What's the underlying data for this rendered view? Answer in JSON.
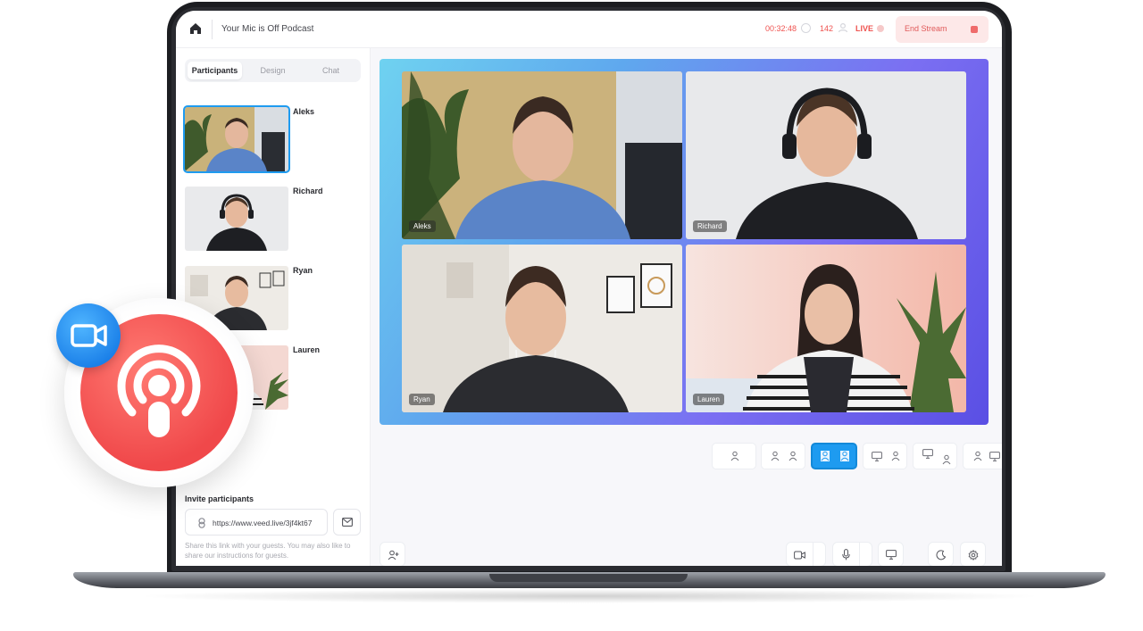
{
  "header": {
    "title": "Your Mic is Off Podcast",
    "timer": "00:32:48",
    "viewer_count": "142",
    "live_label": "LIVE",
    "end_stream_label": "End Stream"
  },
  "sidebar": {
    "tabs": [
      {
        "label": "Participants",
        "active": true
      },
      {
        "label": "Design",
        "active": false
      },
      {
        "label": "Chat",
        "active": false
      }
    ],
    "participants": [
      {
        "name": "Aleks",
        "selected": true
      },
      {
        "name": "Richard",
        "selected": false
      },
      {
        "name": "Ryan",
        "selected": false
      },
      {
        "name": "Lauren",
        "selected": false
      }
    ],
    "invite": {
      "title": "Invite participants",
      "link": "https://www.veed.live/3jf4kt67",
      "note": "Share this link with your guests. You may also like to share our instructions for guests."
    }
  },
  "stage": {
    "tiles": [
      {
        "label": "Aleks"
      },
      {
        "label": "Richard"
      },
      {
        "label": "Ryan"
      },
      {
        "label": "Lauren"
      }
    ],
    "layouts": [
      "single",
      "two-person",
      "two-person-selected",
      "screen-person",
      "screen-small-person",
      "person-screen"
    ]
  },
  "colors": {
    "accent": "#1e9bf0",
    "live_red": "#ef5350",
    "end_stream_bg": "#fde8e8",
    "podcast_badge": "#f0484a",
    "camera_badge": "#1a7fe8"
  },
  "icons": {
    "home": "home-icon",
    "clock": "clock-icon",
    "viewers": "person-icon",
    "stop": "stop-icon",
    "link": "link-icon",
    "mail": "mail-icon",
    "add_participant": "add-person-icon",
    "camera": "camera-icon",
    "mic": "mic-icon",
    "screen_share": "screen-icon",
    "dark_mode": "moon-icon",
    "settings": "gear-icon"
  }
}
